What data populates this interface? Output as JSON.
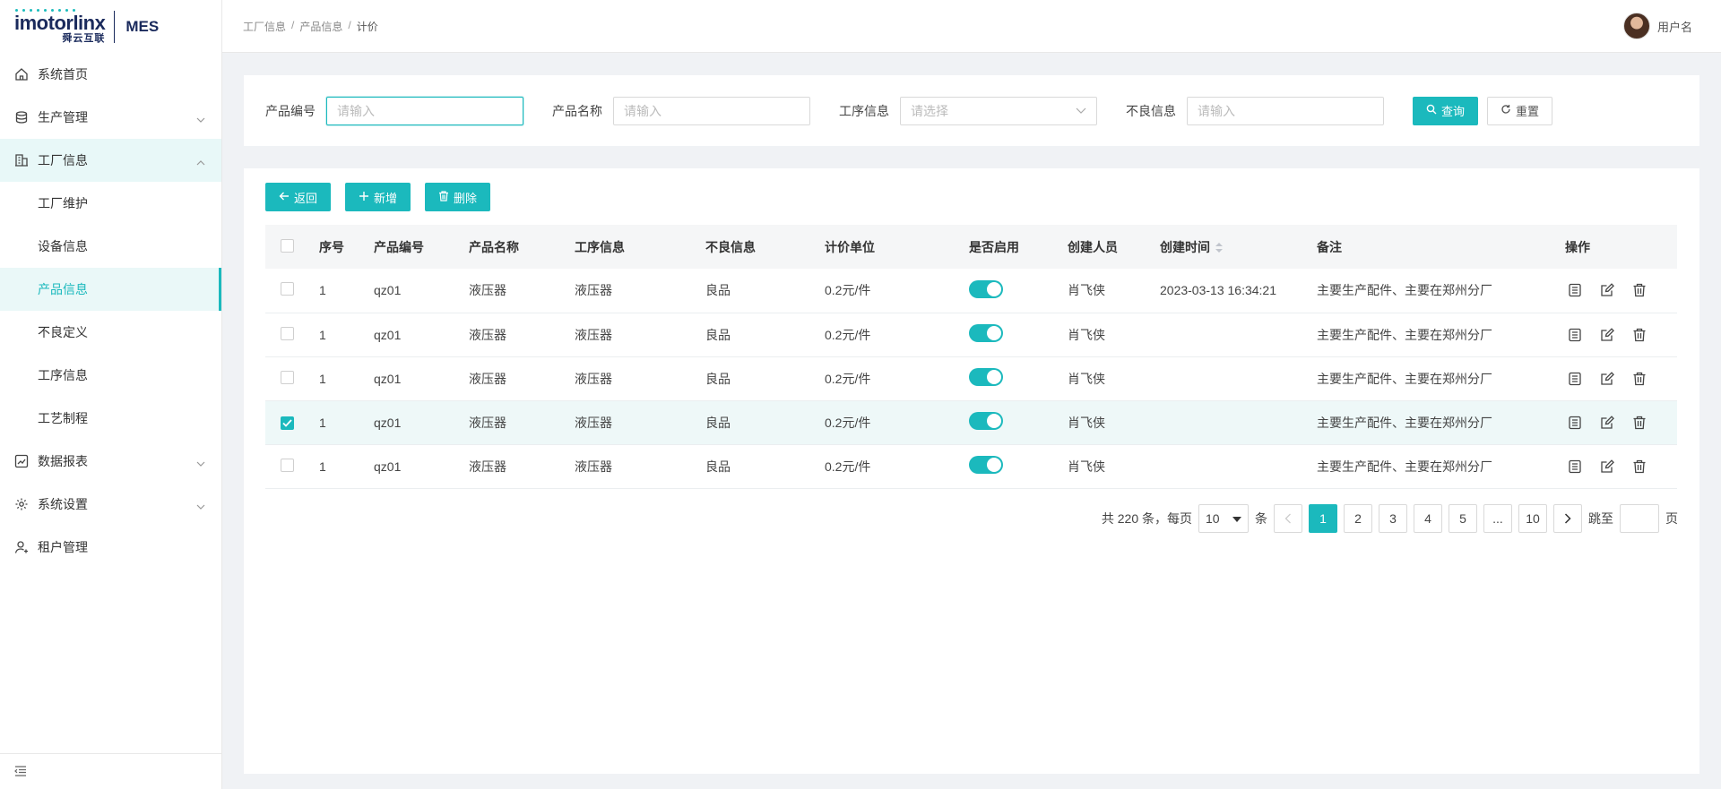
{
  "app": {
    "logo_brand": "imotorlinx",
    "logo_sub": "舜云互联",
    "logo_product": "MES"
  },
  "header": {
    "breadcrumb": [
      "工厂信息",
      "产品信息",
      "计价"
    ],
    "username": "用户名"
  },
  "sidebar": {
    "items": [
      {
        "label": "系统首页",
        "icon": "home-icon"
      },
      {
        "label": "生产管理",
        "icon": "database-icon"
      },
      {
        "label": "工厂信息",
        "icon": "building-icon"
      },
      {
        "label": "数据报表",
        "icon": "chart-icon"
      },
      {
        "label": "系统设置",
        "icon": "gear-icon"
      },
      {
        "label": "租户管理",
        "icon": "user-icon"
      }
    ],
    "sub_items": [
      "工厂维护",
      "设备信息",
      "产品信息",
      "不良定义",
      "工序信息",
      "工艺制程"
    ],
    "active_sub": "产品信息"
  },
  "filter": {
    "product_code_label": "产品编号",
    "product_code_placeholder": "请输入",
    "product_name_label": "产品名称",
    "product_name_placeholder": "请输入",
    "process_label": "工序信息",
    "process_placeholder": "请选择",
    "defect_label": "不良信息",
    "defect_placeholder": "请输入",
    "search_button": "查询",
    "reset_button": "重置"
  },
  "toolbar": {
    "back_button": "返回",
    "add_button": "新增",
    "delete_button": "删除"
  },
  "table": {
    "columns": [
      "序号",
      "产品编号",
      "产品名称",
      "工序信息",
      "不良信息",
      "计价单位",
      "是否启用",
      "创建人员",
      "创建时间",
      "备注",
      "操作"
    ],
    "rows": [
      {
        "seq": "1",
        "code": "qz01",
        "name": "液压器",
        "process": "液压器",
        "defect": "良品",
        "unit": "0.2元/件",
        "enabled": true,
        "creator": "肖飞侠",
        "created": "2023-03-13 16:34:21",
        "remark": "主要生产配件、主要在郑州分厂",
        "checked": false
      },
      {
        "seq": "1",
        "code": "qz01",
        "name": "液压器",
        "process": "液压器",
        "defect": "良品",
        "unit": "0.2元/件",
        "enabled": true,
        "creator": "肖飞侠",
        "created": "",
        "remark": "主要生产配件、主要在郑州分厂",
        "checked": false
      },
      {
        "seq": "1",
        "code": "qz01",
        "name": "液压器",
        "process": "液压器",
        "defect": "良品",
        "unit": "0.2元/件",
        "enabled": true,
        "creator": "肖飞侠",
        "created": "",
        "remark": "主要生产配件、主要在郑州分厂",
        "checked": false
      },
      {
        "seq": "1",
        "code": "qz01",
        "name": "液压器",
        "process": "液压器",
        "defect": "良品",
        "unit": "0.2元/件",
        "enabled": true,
        "creator": "肖飞侠",
        "created": "",
        "remark": "主要生产配件、主要在郑州分厂",
        "checked": true
      },
      {
        "seq": "1",
        "code": "qz01",
        "name": "液压器",
        "process": "液压器",
        "defect": "良品",
        "unit": "0.2元/件",
        "enabled": true,
        "creator": "肖飞侠",
        "created": "",
        "remark": "主要生产配件、主要在郑州分厂",
        "checked": false
      }
    ]
  },
  "pagination": {
    "total_text": "共 220 条，每页",
    "page_size": "10",
    "unit_text": "条",
    "pages": [
      "1",
      "2",
      "3",
      "4",
      "5",
      "...",
      "10"
    ],
    "current_page": "1",
    "jump_label": "跳至",
    "page_label": "页"
  },
  "colors": {
    "accent": "#1bb9bd",
    "brand_navy": "#1a2a5c"
  }
}
